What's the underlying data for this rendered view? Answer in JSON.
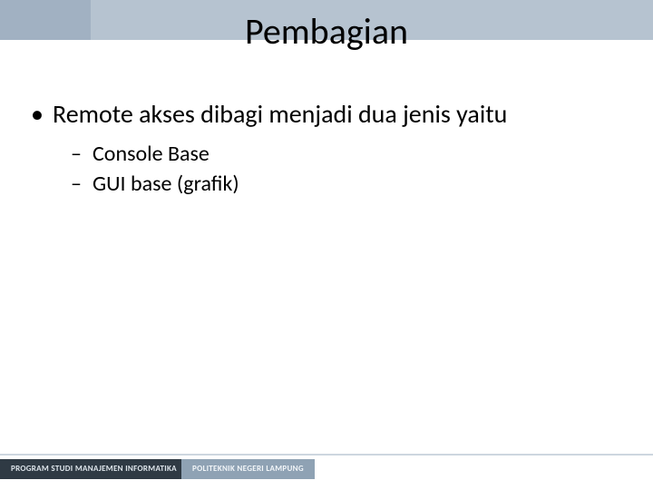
{
  "title": "Pembagian",
  "bullet": {
    "text": "Remote akses dibagi menjadi dua jenis yaitu",
    "sub": [
      "Console Base",
      "GUI base (grafik)"
    ]
  },
  "footer": {
    "left": "PROGRAM STUDI MANAJEMEN INFORMATIKA",
    "mid": "POLITEKNIK NEGERI LAMPUNG"
  }
}
